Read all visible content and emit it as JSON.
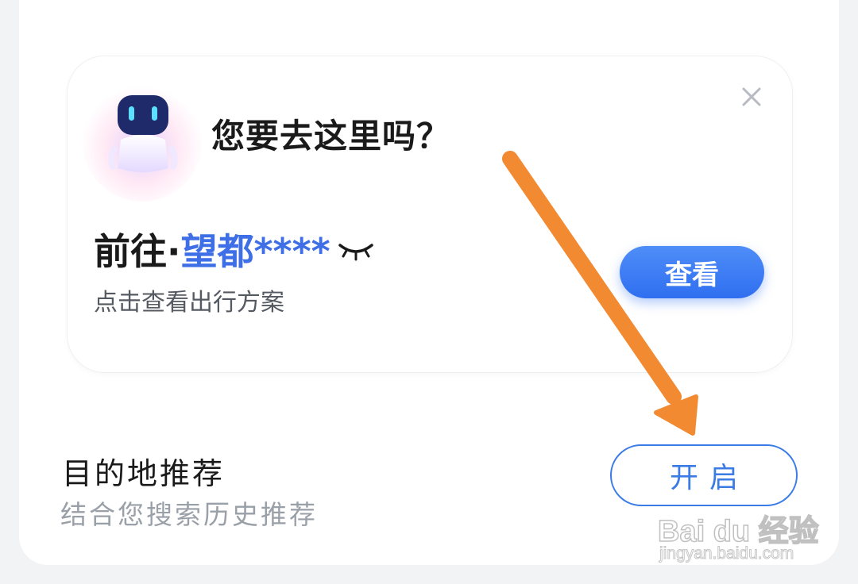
{
  "suggestion_card": {
    "question": "您要去这里吗？",
    "destination_prefix": "前往·",
    "destination_name": "望都****",
    "subtitle": "点击查看出行方案",
    "view_button_label": "查看",
    "bot_icon": "robot-assistant-icon",
    "close_icon": "close-icon",
    "eye_icon": "closed-eye-icon"
  },
  "destination_recommend": {
    "title": "目的地推荐",
    "subtitle": "结合您搜索历史推荐",
    "enable_button_label": "开启"
  },
  "annotation": {
    "arrow_color": "#f28a32",
    "arrow_icon": "orange-arrow"
  },
  "watermark": {
    "logo_text": "Bai du 经验",
    "url_text": "jingyan.baidu.com"
  },
  "colors": {
    "accent_blue": "#3f6fe6",
    "button_blue": "#2f6ff0",
    "outline_blue": "#3a7be6"
  }
}
